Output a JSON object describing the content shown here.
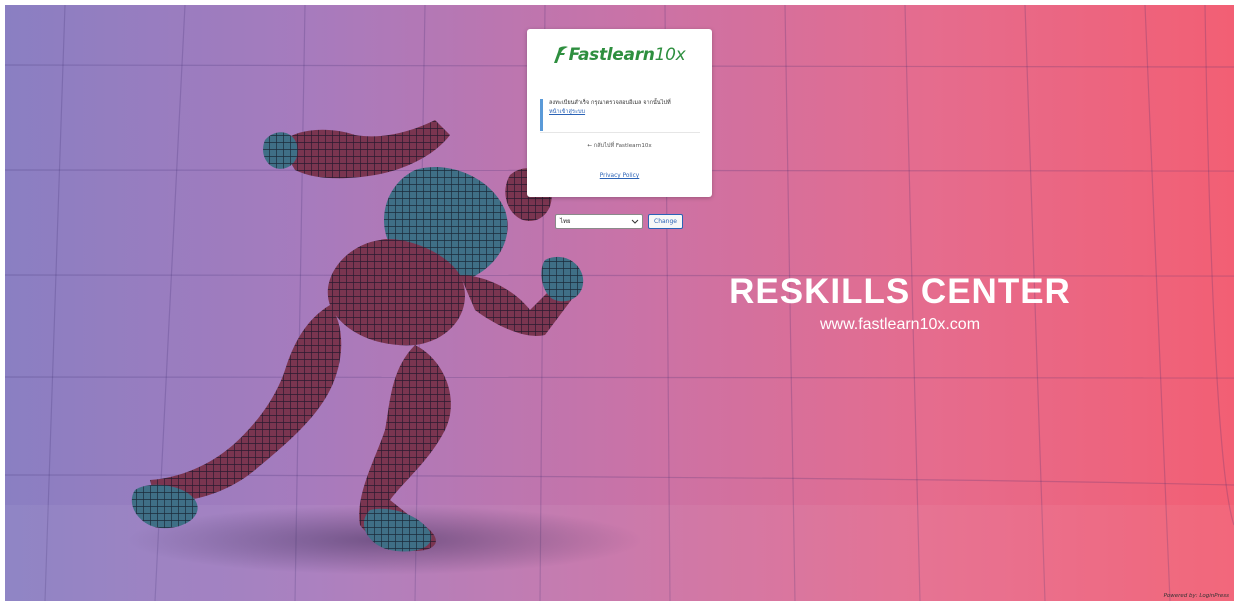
{
  "brand": {
    "logo_bold": "Fastlearn",
    "logo_thin": "10x",
    "logo_color": "#2e8f3f"
  },
  "login": {
    "notice_text": "ลงทะเบียนสำเร็จ กรุณาตรวจสอบอีเมล จากนั้นไปที่",
    "notice_link": "หน้าเข้าสู่ระบบ",
    "back_link": "← กลับไปที่ Fastlearn10x",
    "privacy_link": "Privacy Policy"
  },
  "language": {
    "selected": "ไทย",
    "change_label": "Change",
    "accent_color": "#2b63b6"
  },
  "hero": {
    "headline": "RESKILLS CENTER",
    "url": "www.fastlearn10x.com"
  },
  "footer": {
    "powered_by": "Powered by: LoginPress"
  },
  "icons": {
    "logo_mark": "leaf-f-logo-icon",
    "chevron": "chevron-down-icon"
  },
  "colors": {
    "bg_left": "#8a7fc2",
    "bg_right": "#f25f74",
    "notice_border": "#5a9ad8"
  }
}
